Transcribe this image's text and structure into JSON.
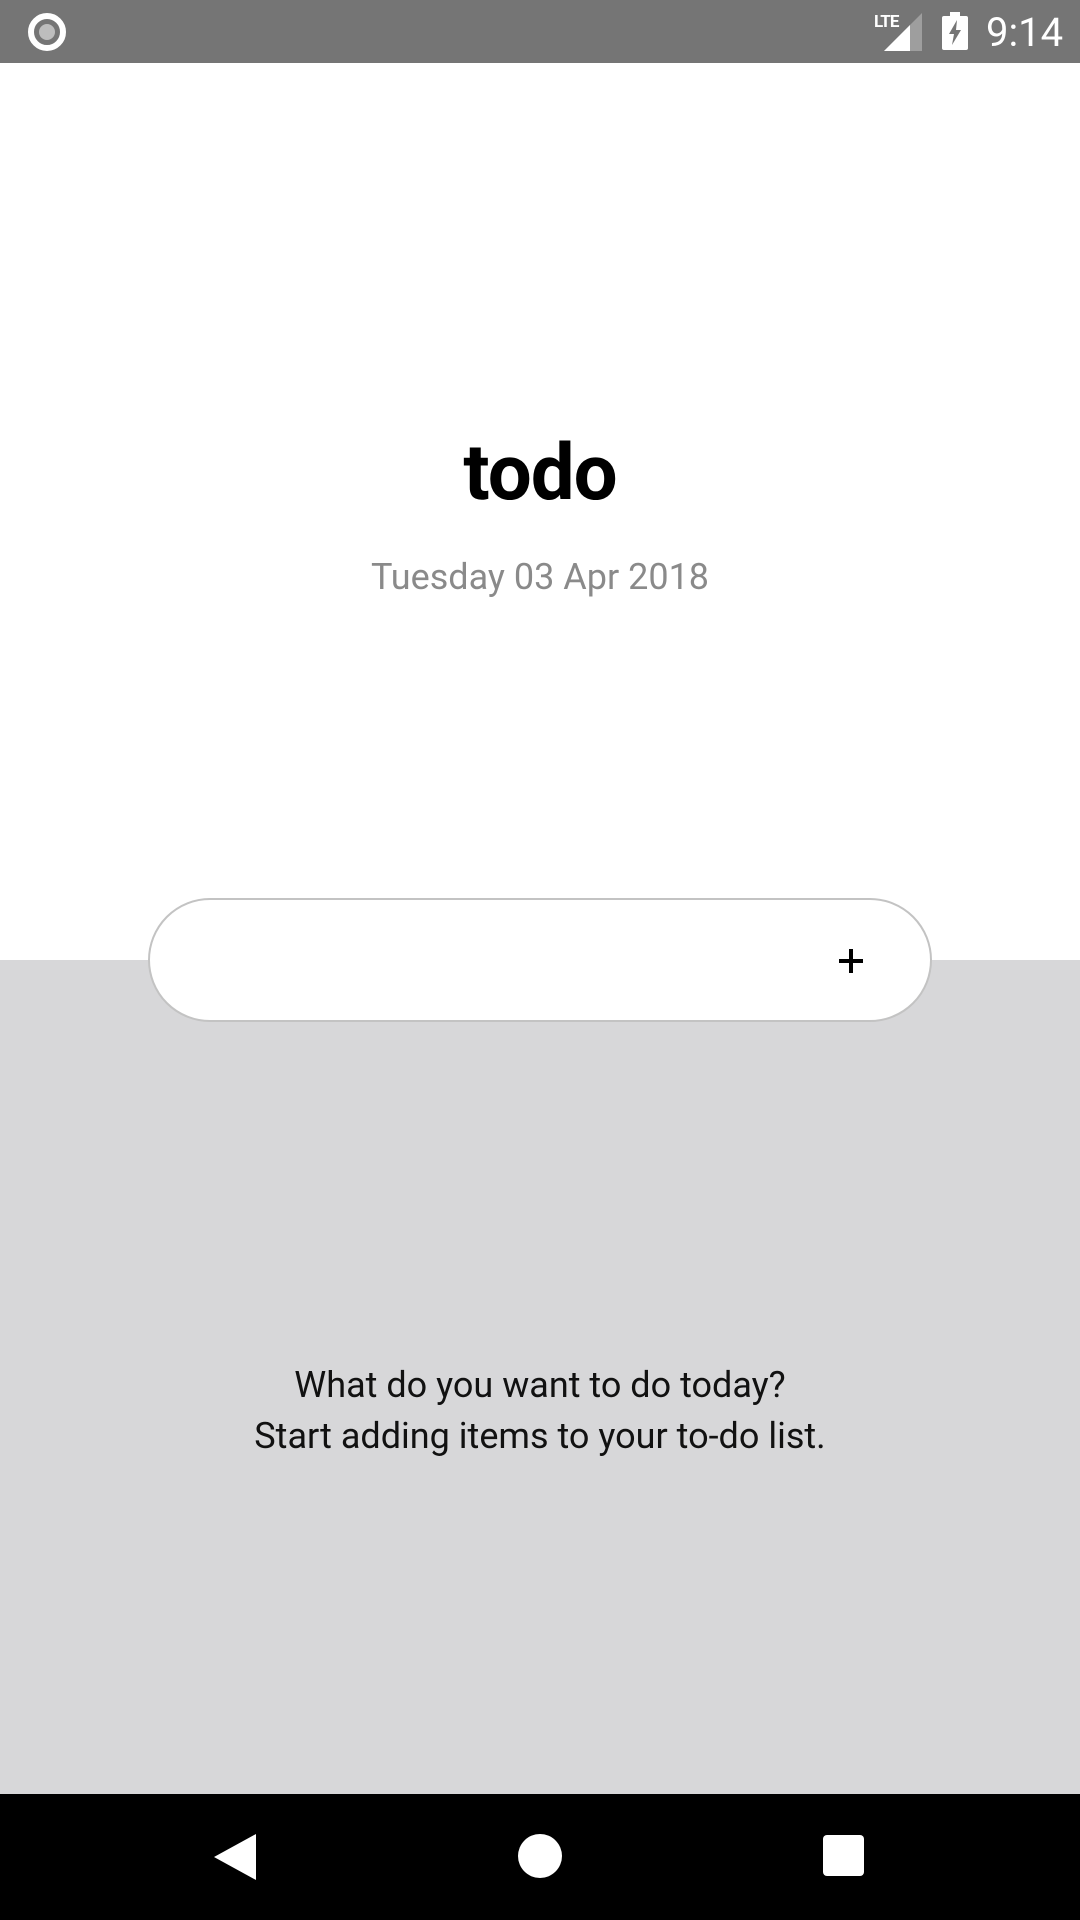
{
  "status_bar": {
    "network_label": "LTE",
    "time": "9:14",
    "icons": [
      "record-indicator-icon",
      "signal-icon",
      "battery-charging-icon"
    ]
  },
  "header": {
    "title": "todo",
    "date": "Tuesday 03 Apr 2018"
  },
  "input": {
    "value": "",
    "placeholder": "",
    "add_label": "+"
  },
  "empty_state": {
    "line1": "What do you want to do today?",
    "line2": "Start adding items to your to-do list."
  },
  "nav_bar": {
    "icons": [
      "back-icon",
      "home-icon",
      "recent-apps-icon"
    ]
  },
  "colors": {
    "status_bar": "#757575",
    "content_background": "#d7d7d9",
    "date_text": "#8a8a8a",
    "nav_bar": "#000000"
  }
}
